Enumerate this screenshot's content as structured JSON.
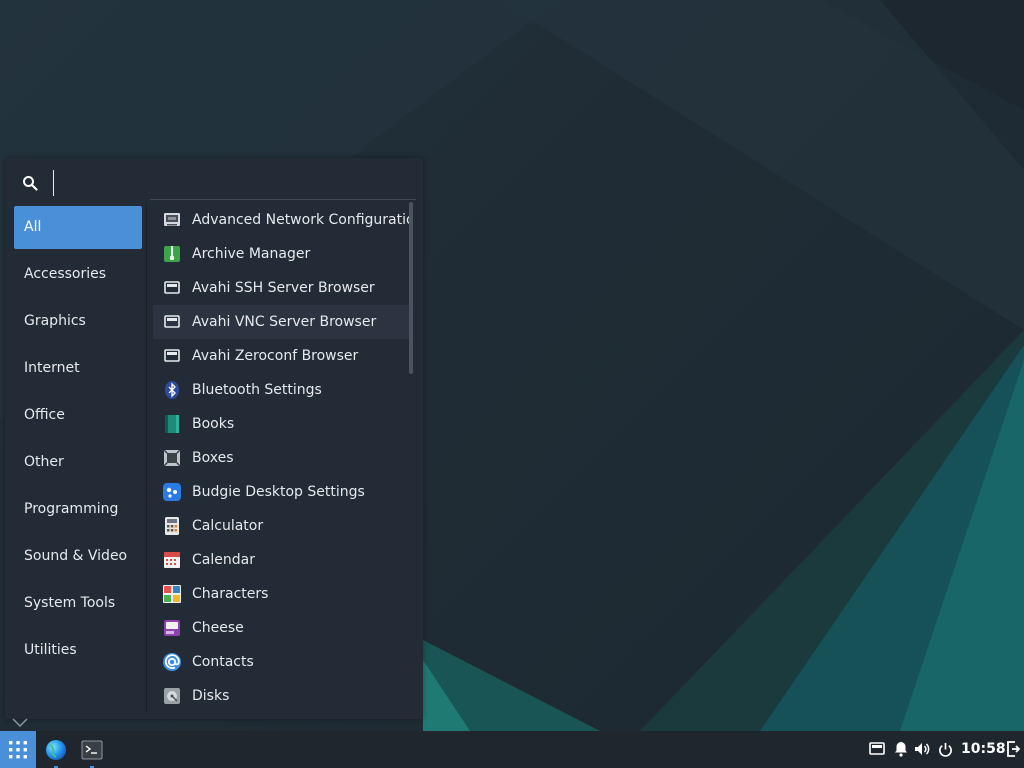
{
  "search": {
    "placeholder": "",
    "value": ""
  },
  "categories": [
    {
      "label": "All",
      "active": true
    },
    {
      "label": "Accessories",
      "active": false
    },
    {
      "label": "Graphics",
      "active": false
    },
    {
      "label": "Internet",
      "active": false
    },
    {
      "label": "Office",
      "active": false
    },
    {
      "label": "Other",
      "active": false
    },
    {
      "label": "Programming",
      "active": false
    },
    {
      "label": "Sound & Video",
      "active": false
    },
    {
      "label": "System Tools",
      "active": false
    },
    {
      "label": "Utilities",
      "active": false
    }
  ],
  "apps": [
    {
      "label": "Advanced Network Configuration",
      "icon": "network-icon"
    },
    {
      "label": "Archive Manager",
      "icon": "archive-icon"
    },
    {
      "label": "Avahi SSH Server Browser",
      "icon": "avahi-icon"
    },
    {
      "label": "Avahi VNC Server Browser",
      "icon": "avahi-icon"
    },
    {
      "label": "Avahi Zeroconf Browser",
      "icon": "avahi-icon"
    },
    {
      "label": "Bluetooth Settings",
      "icon": "bluetooth-icon"
    },
    {
      "label": "Books",
      "icon": "books-icon"
    },
    {
      "label": "Boxes",
      "icon": "boxes-icon"
    },
    {
      "label": "Budgie Desktop Settings",
      "icon": "budgie-settings-icon"
    },
    {
      "label": "Calculator",
      "icon": "calculator-icon"
    },
    {
      "label": "Calendar",
      "icon": "calendar-icon"
    },
    {
      "label": "Characters",
      "icon": "characters-icon"
    },
    {
      "label": "Cheese",
      "icon": "cheese-icon"
    },
    {
      "label": "Contacts",
      "icon": "contacts-icon"
    },
    {
      "label": "Disks",
      "icon": "disks-icon"
    }
  ],
  "panel": {
    "clock": "10:58",
    "tasks": [
      {
        "name": "web-browser-icon"
      },
      {
        "name": "terminal-icon"
      }
    ],
    "tray": [
      "network-tray-icon",
      "notifications-icon",
      "volume-icon",
      "power-icon",
      "logout-icon"
    ]
  },
  "colors": {
    "accent": "#4a90d9",
    "menu_bg": "#232b36",
    "panel_bg": "#20262e",
    "text": "#e6e9ee"
  }
}
